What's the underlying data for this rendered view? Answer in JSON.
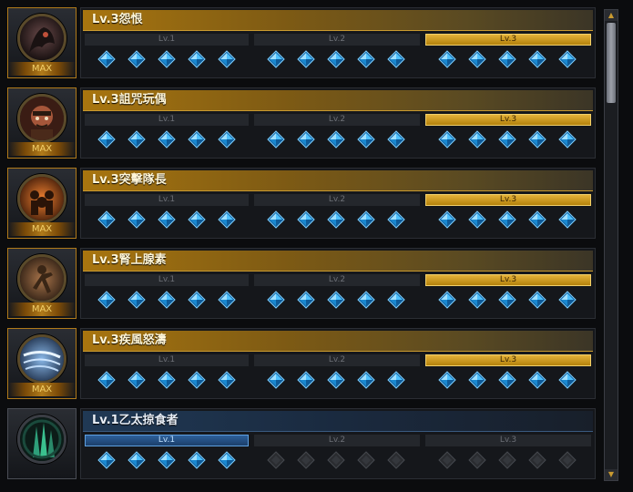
{
  "skills": [
    {
      "name": "Lv.3怨恨",
      "max": "MAX",
      "tiers": [
        "Lv.1",
        "Lv.2",
        "Lv.3"
      ],
      "active_tier": 3,
      "style": "gold",
      "icon": "wraith-icon"
    },
    {
      "name": "Lv.3詛咒玩偶",
      "max": "MAX",
      "tiers": [
        "Lv.1",
        "Lv.2",
        "Lv.3"
      ],
      "active_tier": 3,
      "style": "gold",
      "icon": "cursed-doll-icon"
    },
    {
      "name": "Lv.3突擊隊長",
      "max": "MAX",
      "tiers": [
        "Lv.1",
        "Lv.2",
        "Lv.3"
      ],
      "active_tier": 3,
      "style": "gold",
      "icon": "assault-captain-icon"
    },
    {
      "name": "Lv.3腎上腺素",
      "max": "MAX",
      "tiers": [
        "Lv.1",
        "Lv.2",
        "Lv.3"
      ],
      "active_tier": 3,
      "style": "gold",
      "icon": "adrenaline-icon"
    },
    {
      "name": "Lv.3疾風怒濤",
      "max": "MAX",
      "tiers": [
        "Lv.1",
        "Lv.2",
        "Lv.3"
      ],
      "active_tier": 3,
      "style": "gold",
      "icon": "gale-icon"
    },
    {
      "name": "Lv.1乙太掠食者",
      "max": "",
      "tiers": [
        "Lv.1",
        "Lv.2",
        "Lv.3"
      ],
      "active_tier": 1,
      "style": "blue",
      "icon": "aether-predator-icon"
    }
  ],
  "colors": {
    "gold": "#e4b23a",
    "blue_gem": "#2aa8f0",
    "dim_gem": "#3a3d42"
  }
}
